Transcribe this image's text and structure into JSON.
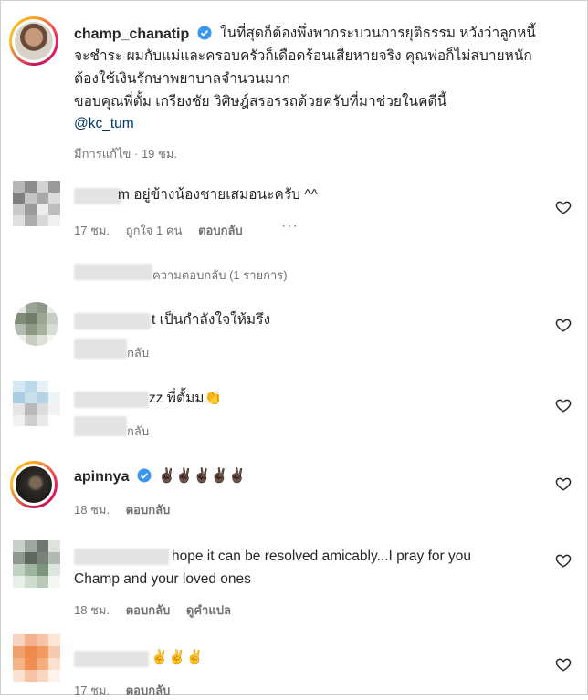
{
  "caption": {
    "username": "champ_chanatip",
    "lines": [
      "ในที่สุดก็ต้องพึ่งพากระบวนการยุติธรรม หวังว่าลูกหนี้",
      "จะชำระ ผมกับแม่และครอบครัวก็เดือดร้อนเสียหายจริง คุณพ่อก็ไม่สบายหนัก",
      "ต้องใช้เงินรักษาพยาบาลจำนวนมาก",
      "ขอบคุณพี่ตั้ม เกรียงชัย วิศิษฎ์สรอรรถด้วยครับที่มาช่วยในคดีนี้"
    ],
    "mention": "@kc_tum",
    "meta": "มีการแก้ไข · 19 ชม."
  },
  "comments": [
    {
      "text": "m อยู่ข้างน้องชายเสมอนะครับ ^^",
      "time": "17 ชม.",
      "likes": "ถูกใจ 1 คน",
      "reply": "ตอบกลับ",
      "more": "···",
      "view_replies": "ความตอบกลับ (1 รายการ)"
    },
    {
      "text": "t เป็นกำลังใจให้มรึง",
      "reply_partial": "กลับ"
    },
    {
      "text": "zz พี่ตั้มม👏",
      "reply_partial": "กลับ"
    },
    {
      "username": "apinnya",
      "text": "✌🏿✌🏿✌🏿✌🏿✌🏿",
      "time": "18 ชม.",
      "reply": "ตอบกลับ"
    },
    {
      "text_line1": "hope it can be resolved amicably...I pray for you",
      "text_line2": "Champ and your loved ones",
      "time": "18 ชม.",
      "reply": "ตอบกลับ",
      "translate": "ดูคำแปล"
    },
    {
      "text": "✌️✌️✌️",
      "time": "17 ชม.",
      "reply": "ตอบกลับ"
    }
  ]
}
